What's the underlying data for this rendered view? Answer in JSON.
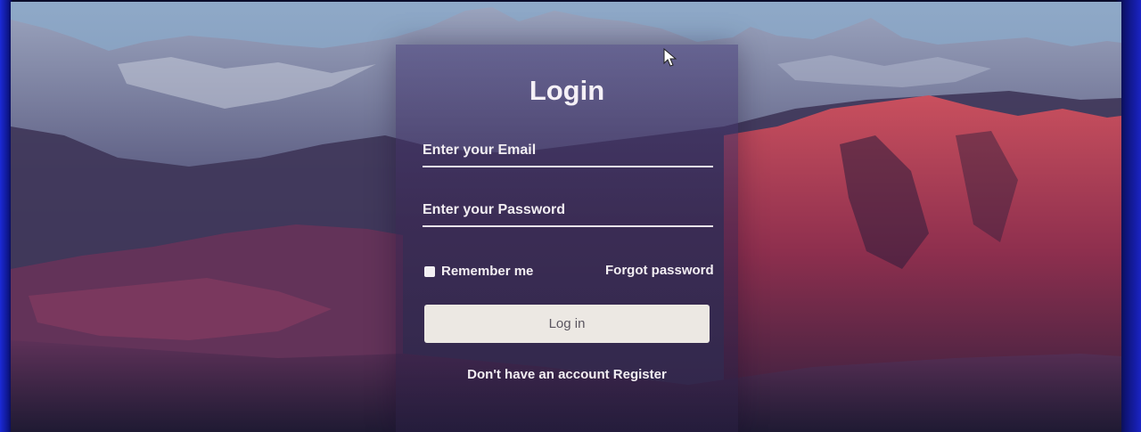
{
  "login": {
    "title": "Login",
    "email_placeholder": "Enter your Email",
    "password_placeholder": "Enter your Password",
    "remember_label": "Remember me",
    "forgot_label": "Forgot password",
    "login_button_label": "Log in",
    "register_prompt": "Don't have an account",
    "register_link": "Register"
  },
  "background": {
    "description_icon": "mountain-landscape-wallpaper"
  },
  "colors": {
    "text": "#f2eef2",
    "button": "#ece8e3",
    "button_text": "#5b5660",
    "bezel": "#1b2ad8"
  }
}
